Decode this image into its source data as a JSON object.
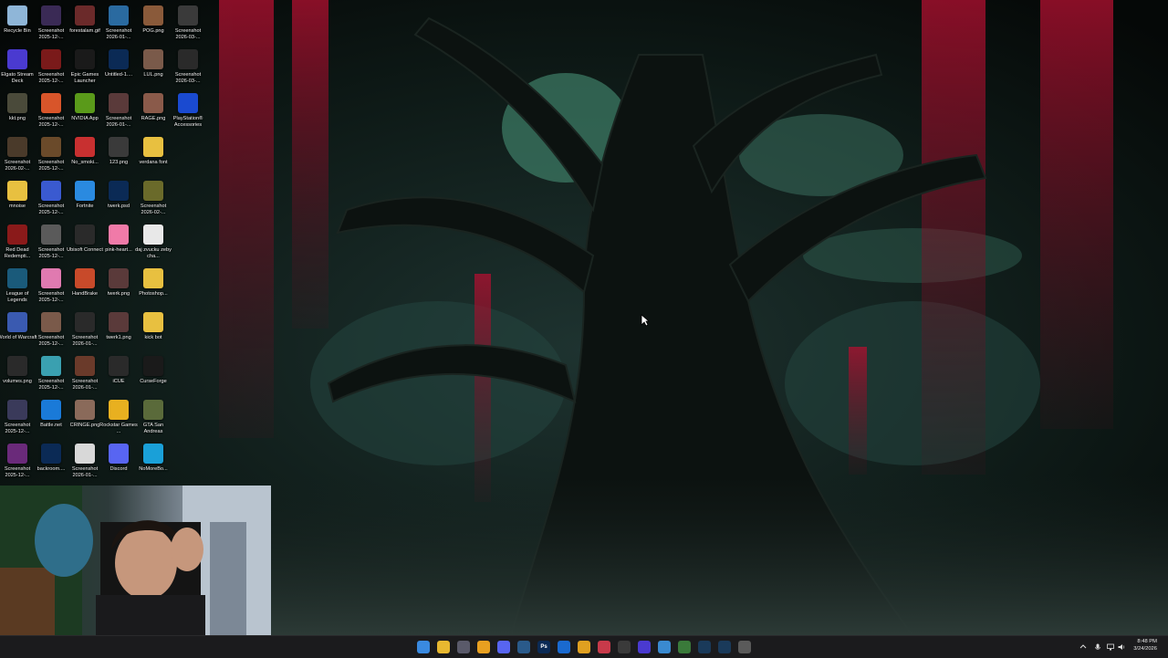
{
  "desktop": {
    "icons": [
      {
        "label": "Recycle Bin",
        "icon": "recycle-bin-icon",
        "color": "#8fb6d8"
      },
      {
        "label": "Screenshot 2025-12-...",
        "icon": "image-icon",
        "color": "#3a2a55"
      },
      {
        "label": "forestalam.gif",
        "icon": "image-icon",
        "color": "#6b2a2a"
      },
      {
        "label": "Screenshot 2026-01-...",
        "icon": "image-icon",
        "color": "#2a6aa0"
      },
      {
        "label": "POG.png",
        "icon": "image-icon",
        "color": "#8a5a3a"
      },
      {
        "label": "Screenshot 2026-03-...",
        "icon": "image-icon",
        "color": "#3a3a3a"
      },
      {
        "label": "Elgato Stream Deck",
        "icon": "stream-deck-icon",
        "color": "#4a3ad0"
      },
      {
        "label": "Screenshot 2025-12-...",
        "icon": "image-icon",
        "color": "#7a1a1a"
      },
      {
        "label": "Epic Games Launcher",
        "icon": "epic-games-icon",
        "color": "#1a1a1a"
      },
      {
        "label": "Untitled-1....",
        "icon": "photoshop-file-icon",
        "color": "#0b2a55"
      },
      {
        "label": "LUL.png",
        "icon": "image-icon",
        "color": "#7a5a4a"
      },
      {
        "label": "Screenshot 2026-03-...",
        "icon": "image-icon",
        "color": "#2a2a2a"
      },
      {
        "label": "kkt.png",
        "icon": "image-icon",
        "color": "#4a4a3a"
      },
      {
        "label": "Screenshot 2025-12-...",
        "icon": "firefox-icon",
        "color": "#d8552a"
      },
      {
        "label": "NVIDIA App",
        "icon": "nvidia-icon",
        "color": "#5a9a1a"
      },
      {
        "label": "Screenshot 2026-01-...",
        "icon": "image-icon",
        "color": "#5a3a3a"
      },
      {
        "label": "RAGE.png",
        "icon": "image-icon",
        "color": "#8a5a4a"
      },
      {
        "label": "PlayStation® Accessories",
        "icon": "playstation-icon",
        "color": "#1a4ad0"
      },
      {
        "label": "Screenshot 2026-02-...",
        "icon": "image-icon",
        "color": "#4a3a2a"
      },
      {
        "label": "Screenshot 2025-12-...",
        "icon": "image-icon",
        "color": "#6a4a2a"
      },
      {
        "label": "No_smoki...",
        "icon": "no-smoking-icon",
        "color": "#c83030"
      },
      {
        "label": "123.png",
        "icon": "image-icon",
        "color": "#3a3a3a"
      },
      {
        "label": "verdana font",
        "icon": "folder-icon",
        "color": "#e8c040"
      },
      {
        "label": "mnoise",
        "icon": "folder-icon",
        "color": "#e8c040"
      },
      {
        "label": "Screenshot 2025-12-...",
        "icon": "image-icon",
        "color": "#3a5ad0"
      },
      {
        "label": "Fortnite",
        "icon": "fortnite-icon",
        "color": "#2a8ae0"
      },
      {
        "label": "twerk.psd",
        "icon": "photoshop-file-icon",
        "color": "#0b2a55"
      },
      {
        "label": "Screenshot 2026-02-...",
        "icon": "image-icon",
        "color": "#6a6a2a"
      },
      {
        "label": "Red Dead Redempti...",
        "icon": "red-dead-icon",
        "color": "#8a1a1a"
      },
      {
        "label": "Screenshot 2025-12-...",
        "icon": "image-icon",
        "color": "#5a5a5a"
      },
      {
        "label": "Ubisoft Connect",
        "icon": "ubisoft-icon",
        "color": "#2a2a2a"
      },
      {
        "label": "pink-heart...",
        "icon": "heart-icon",
        "color": "#f07aa8"
      },
      {
        "label": "daj zvucku zeby cha...",
        "icon": "text-file-icon",
        "color": "#e8e8e8"
      },
      {
        "label": "League of Legends",
        "icon": "league-icon",
        "color": "#1a5a7a"
      },
      {
        "label": "Screenshot 2025-12-...",
        "icon": "image-icon",
        "color": "#e07ab0"
      },
      {
        "label": "HandBrake",
        "icon": "handbrake-icon",
        "color": "#c84a2a"
      },
      {
        "label": "twerk.png",
        "icon": "image-icon",
        "color": "#5a3a3a"
      },
      {
        "label": "Photoshop...",
        "icon": "folder-icon",
        "color": "#e8c040"
      },
      {
        "label": "World of Warcraft",
        "icon": "wow-icon",
        "color": "#3a5ab0"
      },
      {
        "label": "Screenshot 2025-12-...",
        "icon": "image-icon",
        "color": "#7a5a4a"
      },
      {
        "label": "Screenshot 2026-01-...",
        "icon": "image-icon",
        "color": "#2a2a2a"
      },
      {
        "label": "twerk1.png",
        "icon": "image-icon",
        "color": "#5a3a3a"
      },
      {
        "label": "kick bot",
        "icon": "folder-icon",
        "color": "#e8c040"
      },
      {
        "label": "volumes.png",
        "icon": "image-icon",
        "color": "#2a2a2a"
      },
      {
        "label": "Screenshot 2025-12-...",
        "icon": "image-icon",
        "color": "#3aa0b0"
      },
      {
        "label": "Screenshot 2026-01-...",
        "icon": "image-icon",
        "color": "#6a3a2a"
      },
      {
        "label": "iCUE",
        "icon": "icue-icon",
        "color": "#2a2a2a"
      },
      {
        "label": "CurseForge",
        "icon": "curseforge-icon",
        "color": "#1a1a1a"
      },
      {
        "label": "Screenshot 2025-12-...",
        "icon": "image-icon",
        "color": "#3a3a5a"
      },
      {
        "label": "Battle.net",
        "icon": "battlenet-icon",
        "color": "#1a7ad8"
      },
      {
        "label": "CRINGE.png",
        "icon": "image-icon",
        "color": "#8a6a5a"
      },
      {
        "label": "Rockstar Games ...",
        "icon": "rockstar-icon",
        "color": "#e8b020"
      },
      {
        "label": "GTA San Andreas",
        "icon": "gta-icon",
        "color": "#5a6a3a"
      },
      {
        "label": "Screenshot 2025-12-...",
        "icon": "image-icon",
        "color": "#6a2a7a"
      },
      {
        "label": "backroom....",
        "icon": "photoshop-file-icon",
        "color": "#0b2a55"
      },
      {
        "label": "Screenshot 2026-01-...",
        "icon": "image-icon",
        "color": "#d8d8d8"
      },
      {
        "label": "Discord",
        "icon": "discord-icon",
        "color": "#5865f2"
      },
      {
        "label": "NoMoreBo...",
        "icon": "app-icon",
        "color": "#1aa0d8"
      }
    ]
  },
  "taskbar": {
    "apps": [
      {
        "name": "start-button",
        "color": "#3a8ae0",
        "glyph": ""
      },
      {
        "name": "file-explorer-icon",
        "color": "#e8b830",
        "glyph": ""
      },
      {
        "name": "app-icon",
        "color": "#5a5a6a",
        "glyph": ""
      },
      {
        "name": "folder-icon",
        "color": "#e8a020",
        "glyph": ""
      },
      {
        "name": "discord-icon",
        "color": "#5865f2",
        "glyph": ""
      },
      {
        "name": "app-icon",
        "color": "#2a5a8a",
        "glyph": ""
      },
      {
        "name": "photoshop-icon",
        "color": "#0b2a55",
        "glyph": "Ps"
      },
      {
        "name": "app-icon",
        "color": "#1a6ad0",
        "glyph": ""
      },
      {
        "name": "chrome-icon",
        "color": "#e0a020",
        "glyph": ""
      },
      {
        "name": "app-icon",
        "color": "#c83a4a",
        "glyph": ""
      },
      {
        "name": "app-icon",
        "color": "#3a3a3a",
        "glyph": ""
      },
      {
        "name": "stream-deck-icon",
        "color": "#4a3ad0",
        "glyph": ""
      },
      {
        "name": "app-icon",
        "color": "#3a8ad0",
        "glyph": ""
      },
      {
        "name": "app-icon",
        "color": "#3a7a3a",
        "glyph": ""
      },
      {
        "name": "steam-icon",
        "color": "#1a3a5a",
        "glyph": ""
      },
      {
        "name": "steam-icon",
        "color": "#1a3a5a",
        "glyph": ""
      },
      {
        "name": "app-icon",
        "color": "#5a5a5a",
        "glyph": ""
      }
    ],
    "clock": {
      "time": "8:48 PM",
      "date": "3/24/2026"
    }
  }
}
